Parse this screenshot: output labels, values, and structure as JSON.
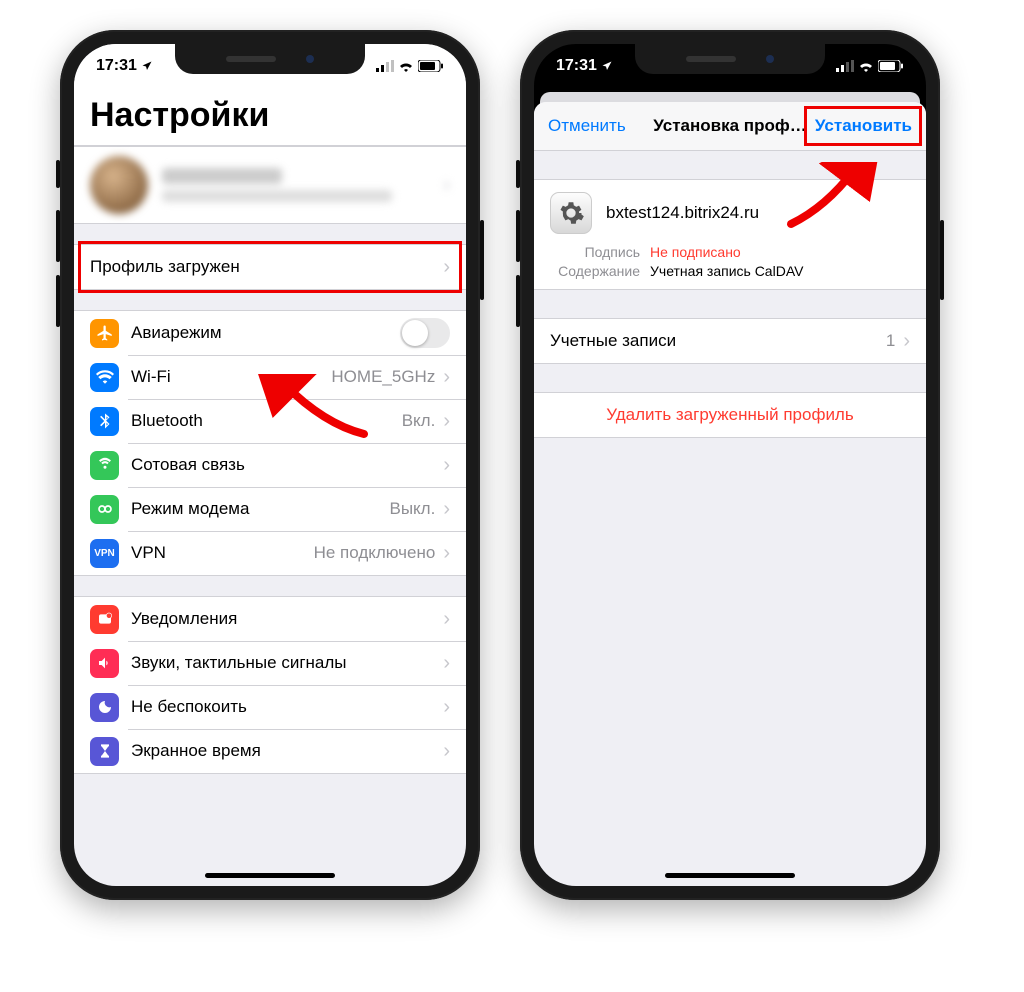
{
  "status": {
    "time": "17:31"
  },
  "screen1": {
    "title": "Настройки",
    "profile_row": "Профиль загружен",
    "rows": {
      "airplane": "Авиарежим",
      "wifi_label": "Wi-Fi",
      "wifi_value": "HOME_5GHz",
      "bluetooth_label": "Bluetooth",
      "bluetooth_value": "Вкл.",
      "cellular": "Сотовая связь",
      "hotspot_label": "Режим модема",
      "hotspot_value": "Выкл.",
      "vpn_label": "VPN",
      "vpn_value": "Не подключено",
      "notifications": "Уведомления",
      "sounds": "Звуки, тактильные сигналы",
      "dnd": "Не беспокоить",
      "screentime": "Экранное время"
    }
  },
  "screen2": {
    "cancel": "Отменить",
    "title": "Установка проф…",
    "install": "Установить",
    "profile_name": "bxtest124.bitrix24.ru",
    "signature_key": "Подпись",
    "signature_val": "Не подписано",
    "contents_key": "Содержание",
    "contents_val": "Учетная запись CalDAV",
    "accounts_label": "Учетные записи",
    "accounts_count": "1",
    "delete": "Удалить загруженный профиль"
  },
  "colors": {
    "orange": "#ff9500",
    "blue": "#007aff",
    "green": "#34c759",
    "red": "#ff3b30",
    "indigo": "#5856d6",
    "vpnblue": "#1d6ef0"
  }
}
